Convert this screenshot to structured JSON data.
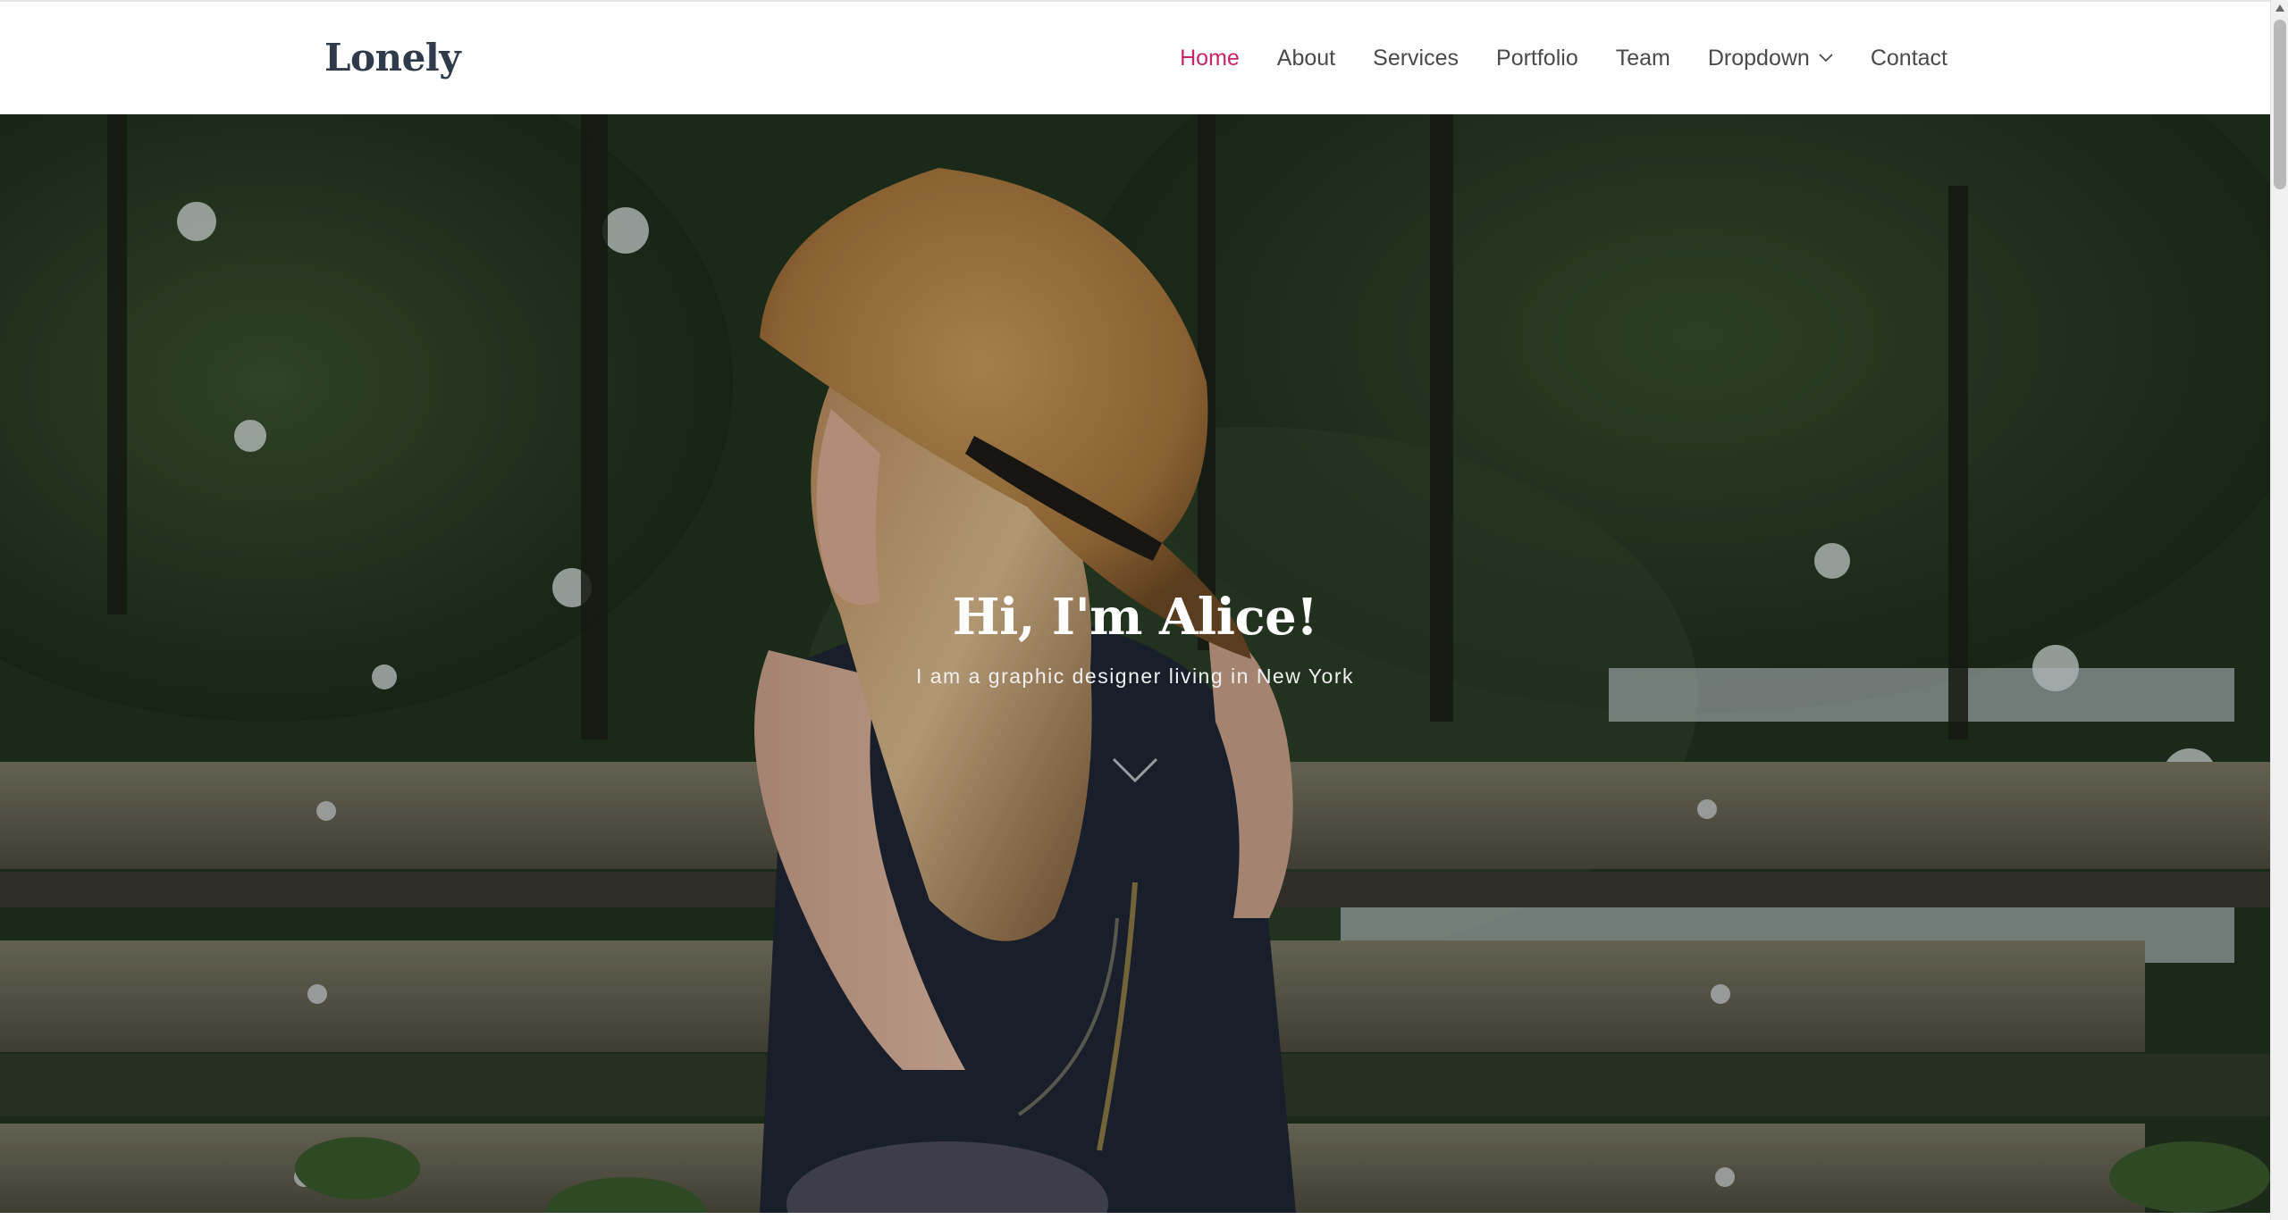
{
  "site": {
    "logo": "Lonely"
  },
  "nav": {
    "items": [
      {
        "label": "Home",
        "active": true
      },
      {
        "label": "About",
        "active": false
      },
      {
        "label": "Services",
        "active": false
      },
      {
        "label": "Portfolio",
        "active": false
      },
      {
        "label": "Team",
        "active": false
      },
      {
        "label": "Dropdown",
        "active": false,
        "has_caret": true
      },
      {
        "label": "Contact",
        "active": false
      }
    ],
    "active_color": "#c7246c"
  },
  "hero": {
    "title": "Hi, I'm Alice!",
    "subtitle": "I am a graphic designer living in New York",
    "scroll_icon": "chevron-down-icon"
  },
  "colors": {
    "logo": "#2f3a4a",
    "nav_text": "#4a4a4a",
    "accent": "#c7246c"
  }
}
